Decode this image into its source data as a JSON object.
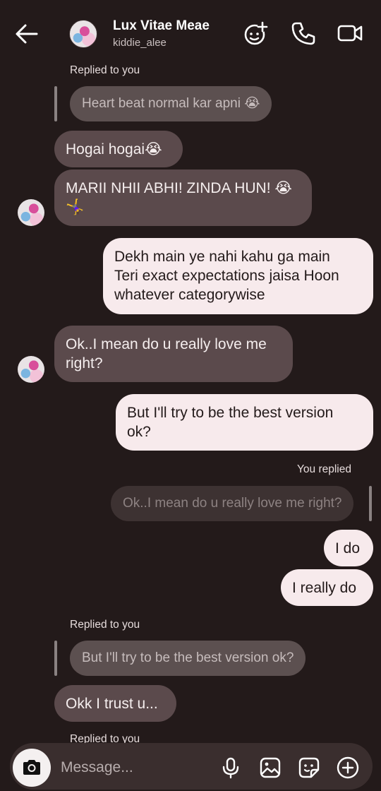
{
  "header": {
    "title": "Lux Vitae Meae",
    "subtitle": "kiddie_alee"
  },
  "messages": {
    "m1_meta": "Replied to you",
    "m1_quote": "Heart beat normal kar apni 😭",
    "m2": "Hogai hogai😭",
    "m3_line1": "MARII NHII ABHI! ZINDA HUN! 😭",
    "m3_line2": "🤸‍♀️",
    "m4_line1": "Dekh main ye nahi kahu ga main",
    "m4_line2": "Teri exact expectations jaisa Hoon",
    "m4_line3": "whatever categorywise",
    "m5_line1": "Ok..I mean do u really love me",
    "m5_line2": "right?",
    "m6_line1": "But I'll try to be the best version",
    "m6_line2": "ok?",
    "m7_meta": "You replied",
    "m7_quote": "Ok..I mean do u really love me right?",
    "m8": "I do",
    "m9": "I really do",
    "m10_meta": "Replied to you",
    "m10_quote": "But I'll try to be the best version ok?",
    "m11": "Okk I trust u...",
    "m12_meta": "Replied to you"
  },
  "composer": {
    "placeholder": "Message..."
  },
  "icons": {
    "back": "arrow-left-icon",
    "effects": "add-effect-icon",
    "call": "phone-icon",
    "video": "video-camera-icon",
    "camera": "camera-icon",
    "mic": "microphone-icon",
    "gallery": "image-icon",
    "sticker": "sticker-icon",
    "add": "plus-circle-icon"
  }
}
